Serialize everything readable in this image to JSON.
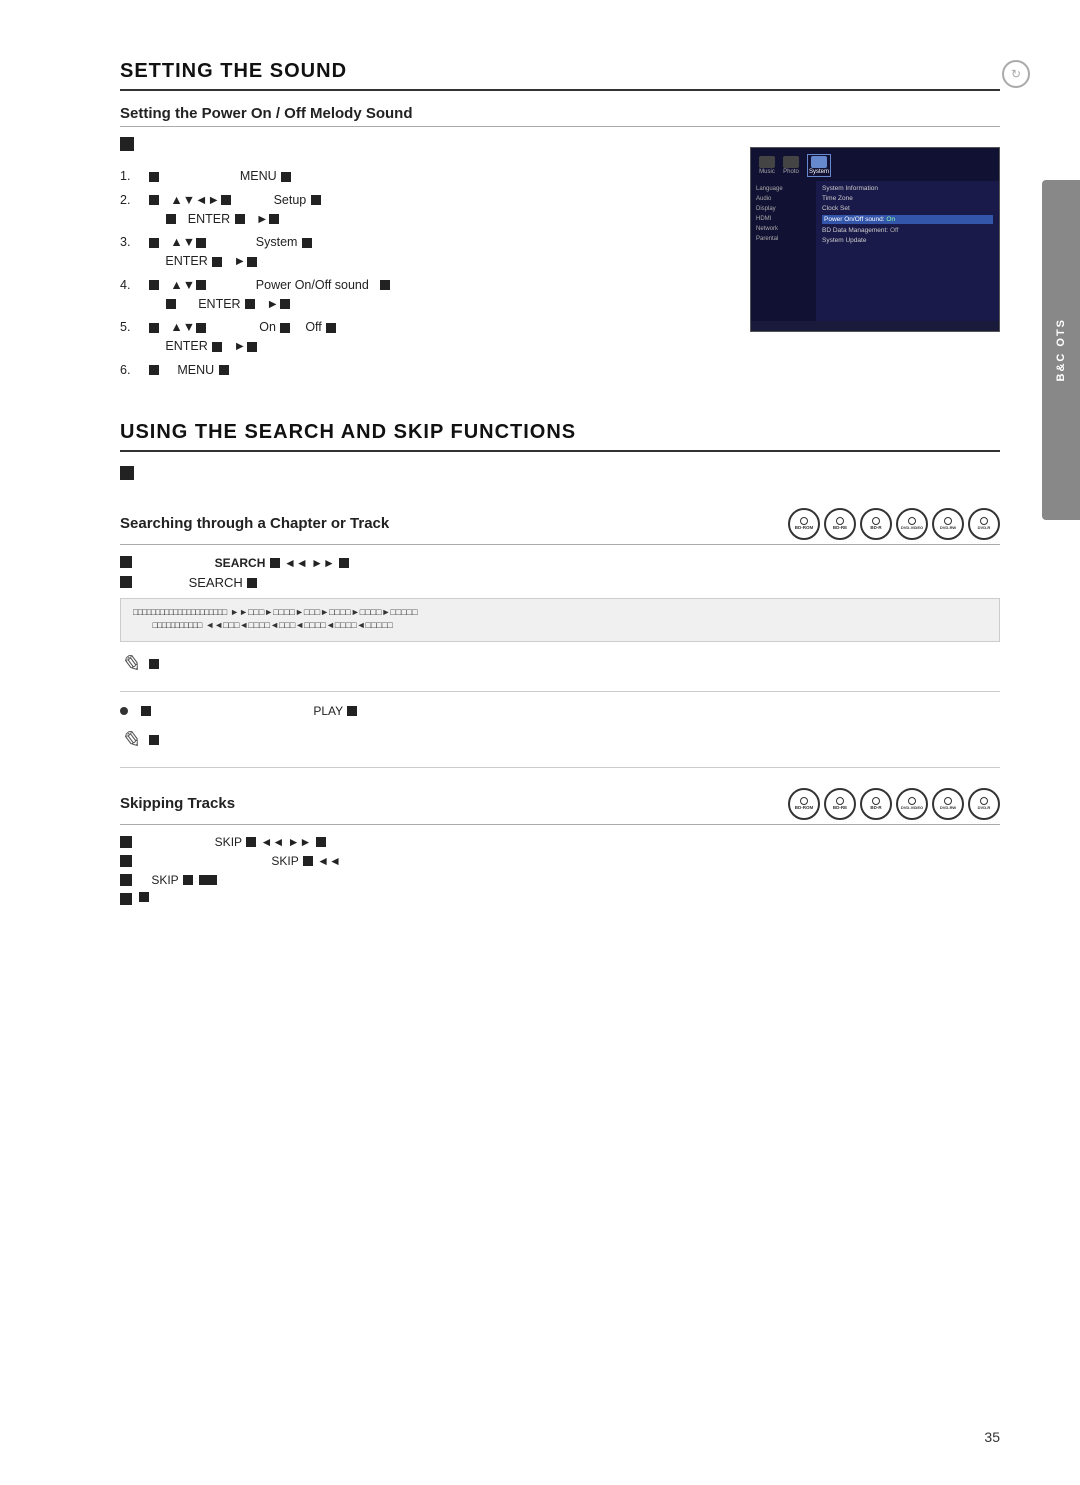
{
  "page": {
    "number": "35",
    "scroll_icon": "↻",
    "side_tab": "B&C OTS"
  },
  "section1": {
    "heading": "SETTING THE SOUND",
    "sub_heading": "Setting the Power On / Off Melody Sound",
    "steps": [
      {
        "num": "1.",
        "text": "MENU ■"
      },
      {
        "num": "2.",
        "text": "▲▼◄►■  Setup ■\n■  ENTER ■  ►■"
      },
      {
        "num": "3.",
        "text": "▲▼■  System ■\nENTER ■  ►■"
      },
      {
        "num": "4.",
        "text": "▲▼■  Power On/Off sound  ■\n■  ENTER ■  ►■"
      },
      {
        "num": "5.",
        "text": "▲▼■  On ■  Off ■\nENTER ■  ►■"
      },
      {
        "num": "6.",
        "text": "■  MENU ■"
      }
    ],
    "menu_items_left": [
      "Music",
      "Photo",
      "System"
    ],
    "menu_items_right": [
      "System Information",
      "Time Zone",
      "Clock Set",
      "Power On/Off sound: On",
      "BD Data Management: Off",
      "System Update"
    ],
    "menu_subitem": [
      "Language",
      "Audio",
      "Display",
      "HDMI",
      "Network",
      "Parental"
    ]
  },
  "section2": {
    "heading": "USING THE SEARCH AND SKIP FUNCTIONS",
    "subsection1": {
      "title": "Searching through a Chapter or Track",
      "discs": [
        "BD-ROM",
        "BD-RE",
        "BD-R",
        "DVD-VIDEO",
        "DVD-RW",
        "DVD-R"
      ],
      "bullet1": "SEARCH ■ ◄◄ ►► ■",
      "bullet2": "SEARCH ■",
      "flow_forward": "►► □□□ ►□□□□ ►□□□ ► □□□□ ► □□□□ ►□□□□□",
      "flow_backward": "◄◄□□□◄□□□□◄□□□◄ □□□□◄ □□□□◄□□□□□",
      "note_text": "■",
      "play_text": "PLAY ■"
    },
    "subsection2": {
      "title": "Skipping Tracks",
      "discs": [
        "BD-ROM",
        "BD-RE",
        "BD-R",
        "DVD-VIDEO",
        "DVD-RW",
        "DVD-R"
      ],
      "bullet1": "SKIP ■ ◄◄ ►► ■",
      "bullet2": "SKIP ■ ◄◄",
      "bullet3": "SKIP ■ ■",
      "bullet4": "■"
    }
  }
}
